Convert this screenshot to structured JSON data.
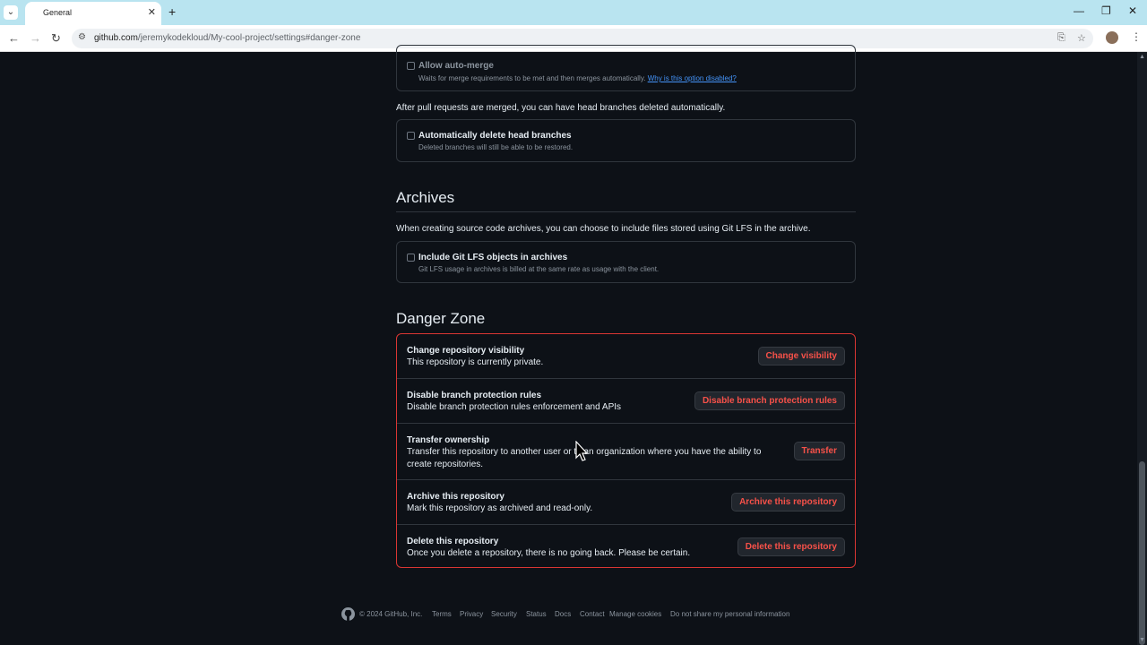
{
  "browser": {
    "tab_title": "General",
    "url_host": "github.com",
    "url_path": "/jeremykodekloud/My-cool-project/settings#danger-zone"
  },
  "merge": {
    "auto_merge_title": "Allow auto-merge",
    "auto_merge_desc": "Waits for merge requirements to be met and then merges automatically.",
    "auto_merge_link": "Why is this option disabled?",
    "after_merge_text": "After pull requests are merged, you can have head branches deleted automatically.",
    "delete_head_title": "Automatically delete head branches",
    "delete_head_desc": "Deleted branches will still be able to be restored."
  },
  "archives": {
    "heading": "Archives",
    "intro": "When creating source code archives, you can choose to include files stored using Git LFS in the archive.",
    "lfs_title": "Include Git LFS objects in archives",
    "lfs_desc": "Git LFS usage in archives is billed at the same rate as usage with the client."
  },
  "danger_zone": {
    "heading": "Danger Zone",
    "rows": [
      {
        "title": "Change repository visibility",
        "desc": "This repository is currently private.",
        "button": "Change visibility"
      },
      {
        "title": "Disable branch protection rules",
        "desc": "Disable branch protection rules enforcement and APIs",
        "button": "Disable branch protection rules"
      },
      {
        "title": "Transfer ownership",
        "desc": "Transfer this repository to another user or to an organization where you have the ability to create repositories.",
        "button": "Transfer"
      },
      {
        "title": "Archive this repository",
        "desc": "Mark this repository as archived and read-only.",
        "button": "Archive this repository"
      },
      {
        "title": "Delete this repository",
        "desc": "Once you delete a repository, there is no going back. Please be certain.",
        "button": "Delete this repository"
      }
    ]
  },
  "footer": {
    "copyright": "© 2024 GitHub, Inc.",
    "links": [
      "Terms",
      "Privacy",
      "Security",
      "Status",
      "Docs",
      "Contact",
      "Manage cookies",
      "Do not share my personal information"
    ]
  },
  "colors": {
    "danger": "#f85149",
    "link": "#4493f8",
    "background": "#0d1117"
  }
}
